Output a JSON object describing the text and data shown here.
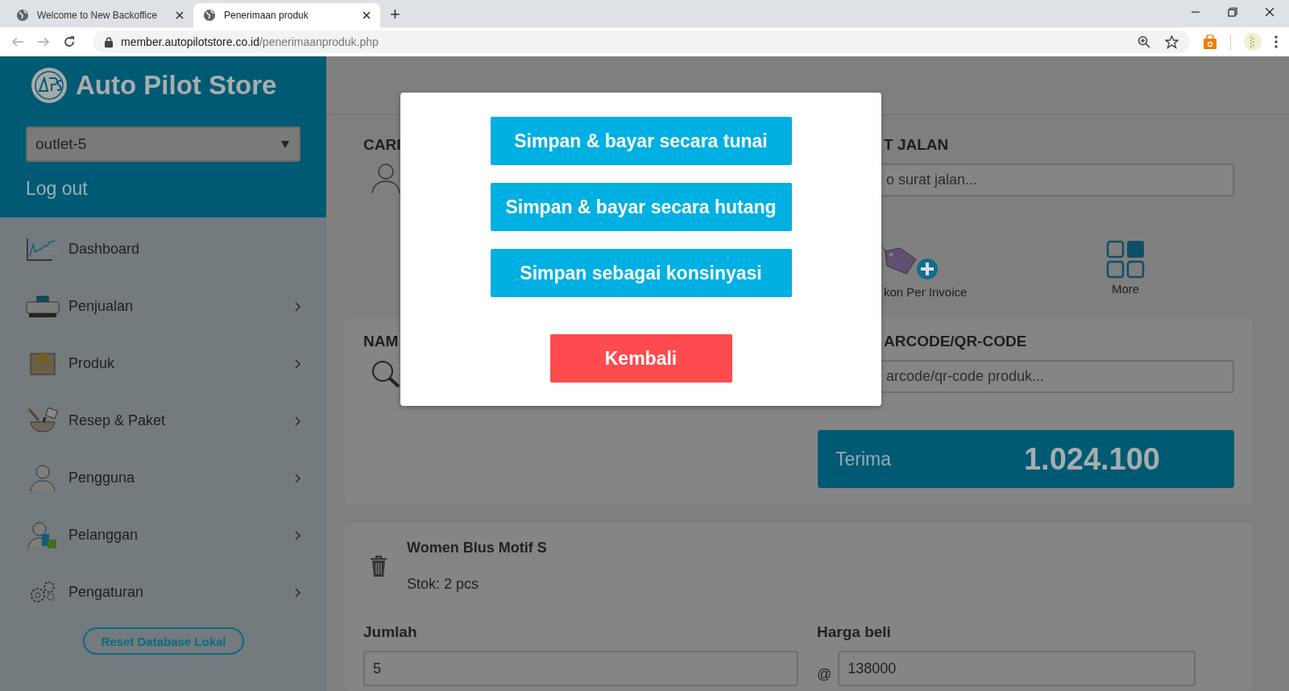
{
  "browser": {
    "tabs": [
      {
        "title": "Welcome to New Backoffice",
        "selected": false
      },
      {
        "title": "Penerimaan produk",
        "selected": true
      }
    ],
    "new_tab": "+",
    "url": {
      "host": "member.autopilotstore.co.id",
      "path": "/penerimaanproduk.php"
    }
  },
  "sidebar": {
    "brand": "Auto Pilot Store",
    "outlet": "outlet-5",
    "logout": "Log out",
    "menu": [
      {
        "label": "Dashboard",
        "submenu": false
      },
      {
        "label": "Penjualan",
        "submenu": true
      },
      {
        "label": "Produk",
        "submenu": true
      },
      {
        "label": "Resep & Paket",
        "submenu": true
      },
      {
        "label": "Pengguna",
        "submenu": true
      },
      {
        "label": "Pelanggan",
        "submenu": true
      },
      {
        "label": "Pengaturan",
        "submenu": true
      }
    ],
    "reset_button": "Reset Database Lokal"
  },
  "main": {
    "customer_label": "CARI",
    "delivery_note": {
      "label": "T JALAN",
      "placeholder": "o surat jalan..."
    },
    "actions": [
      {
        "label": "kon Per Invoice",
        "kind": "discount"
      },
      {
        "label": "More",
        "kind": "more"
      }
    ],
    "product_label": "NAM",
    "barcode": {
      "label": "ARCODE/QR-CODE",
      "placeholder": "arcode/qr-code produk..."
    },
    "receive": {
      "label": "Terima",
      "amount": "1.024.100"
    },
    "item": {
      "name": "Women Blus Motif S",
      "stock": "Stok: 2 pcs",
      "quantity_label": "Jumlah",
      "quantity": "5",
      "price_label": "Harga beli",
      "price_prefix": "@",
      "price": "138000"
    }
  },
  "modal": {
    "buttons": [
      {
        "label": "Simpan & bayar secara tunai",
        "kind": "primary"
      },
      {
        "label": "Simpan & bayar secara hutang",
        "kind": "primary"
      },
      {
        "label": "Simpan sebagai konsinyasi",
        "kind": "primary"
      },
      {
        "label": "Kembali",
        "kind": "danger"
      }
    ]
  }
}
